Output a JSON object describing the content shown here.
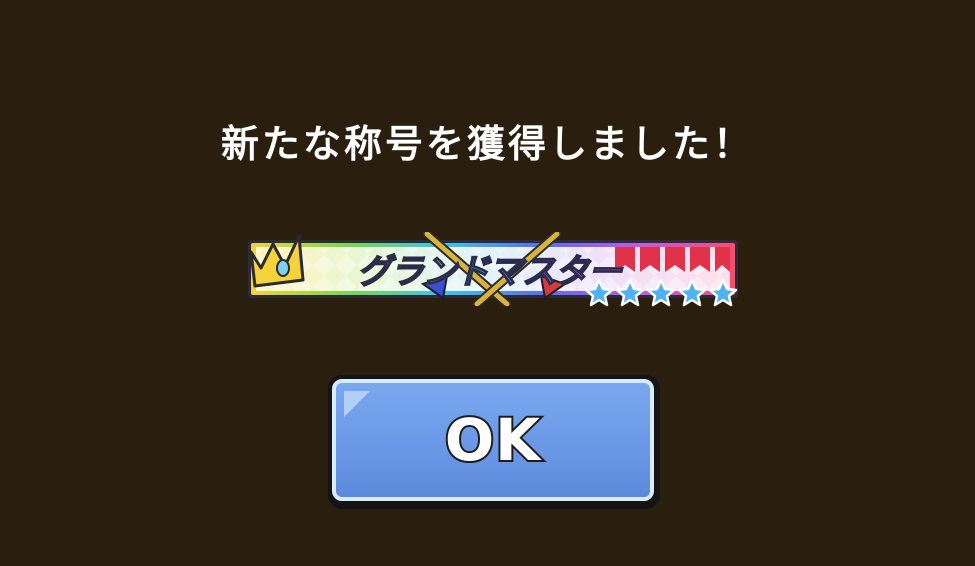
{
  "dialog": {
    "message": "新たな称号を獲得しました！",
    "title_badge": {
      "title_text": "グランドマスター",
      "crown_icon": "crown-icon",
      "crossed_swords_icon": "crossed-swords-icon",
      "star_count": 5,
      "star_icon": "star-icon"
    },
    "ok_button": {
      "label": "OK"
    }
  },
  "colors": {
    "background": "#2a1f0f",
    "button_blue": "#6a97e6",
    "button_border": "#d9ecff",
    "star_blue": "#4fb3f2",
    "crown_gold": "#f5d33a"
  }
}
